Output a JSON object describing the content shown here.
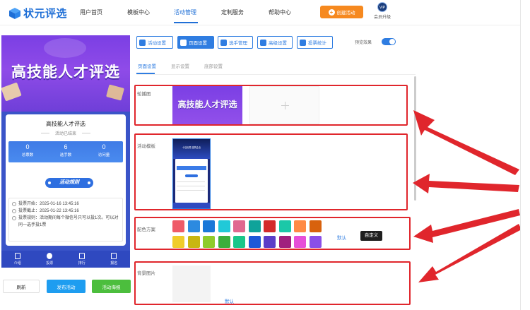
{
  "brand": {
    "name": "状元评选"
  },
  "nav": [
    {
      "label": "用户首页"
    },
    {
      "label": "模板中心"
    },
    {
      "label": "活动管理"
    },
    {
      "label": "定制服务"
    },
    {
      "label": "帮助中心"
    }
  ],
  "header": {
    "create_label": "创建活动",
    "vip_badge": "VIP",
    "vip_label": "会员升级"
  },
  "preview": {
    "banner_title": "高技能人才评选",
    "card_title": "高技能人才评选",
    "status": "活动已结束",
    "stats": [
      {
        "value": "0",
        "label": "总票数"
      },
      {
        "value": "6",
        "label": "选手数"
      },
      {
        "value": "0",
        "label": "访问量"
      }
    ],
    "rules_button": "活动规则",
    "info": [
      "投票开始：2025-01-16 13:45:16",
      "投票截止：2025-01-22 13:45:16",
      "投票规则：活动期间每个微信号只可以投1次。可以对同一选手投1票"
    ],
    "tabs": [
      {
        "label": "介绍"
      },
      {
        "label": "投票"
      },
      {
        "label": "排行"
      },
      {
        "label": "报名"
      }
    ]
  },
  "actions": {
    "refresh": "刷新",
    "publish": "发布活动",
    "poster": "活动海报"
  },
  "toolbar": {
    "buttons": [
      {
        "label": "活动设置"
      },
      {
        "label": "页面设置"
      },
      {
        "label": "选手管理"
      },
      {
        "label": "高级设置"
      },
      {
        "label": "投票统计"
      }
    ],
    "preview_label": "预览效果"
  },
  "subtabs": [
    {
      "label": "页面设置"
    },
    {
      "label": "显示设置"
    },
    {
      "label": "底部设置"
    }
  ],
  "sections": {
    "carousel": {
      "label": "轮播图",
      "image_title": "高技能人才评选"
    },
    "template": {
      "label": "活动模板",
      "thumb_title": "十佳优秀 建筑企业"
    },
    "color": {
      "label": "配色方案",
      "default_label": "默认",
      "custom_label": "自定义",
      "row1": [
        "#ef5b68",
        "#2c8ae0",
        "#1a78d8",
        "#21c9d8",
        "#e0688f",
        "#0fa39a",
        "#d42b2b",
        "#1bc8a8",
        "#ff8a45",
        "#d8620d"
      ],
      "row2": [
        "#f0cc2a",
        "#c8b612",
        "#8fcb2a",
        "#3cae3c",
        "#19c68a",
        "#1d58d8",
        "#5b3dc8",
        "#a0207e",
        "#e64fd8",
        "#8a4fe8"
      ]
    },
    "background": {
      "label": "背景图片",
      "default_label": "默认"
    }
  },
  "colors": {
    "accent": "#2f7de1",
    "orange": "#f6891f",
    "highlight": "#e0262c",
    "green": "#4cbe3d"
  }
}
